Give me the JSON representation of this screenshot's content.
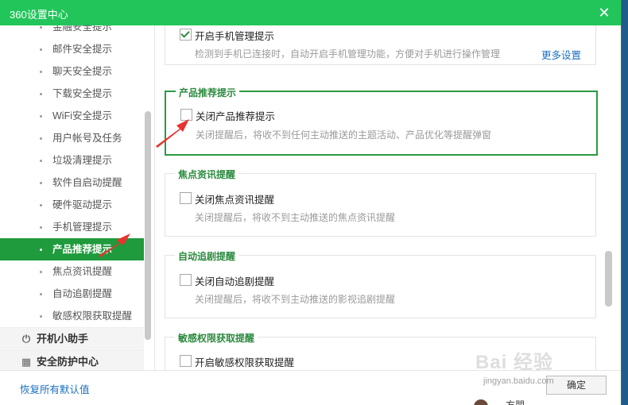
{
  "window": {
    "title": "360设置中心",
    "close_glyph": "✕"
  },
  "sidebar": {
    "items": [
      {
        "label": "金融安全提示",
        "active": false
      },
      {
        "label": "邮件安全提示",
        "active": false
      },
      {
        "label": "聊天安全提示",
        "active": false
      },
      {
        "label": "下载安全提示",
        "active": false
      },
      {
        "label": "WiFi安全提示",
        "active": false
      },
      {
        "label": "用户帐号及任务",
        "active": false
      },
      {
        "label": "垃圾清理提示",
        "active": false
      },
      {
        "label": "软件自启动提醒",
        "active": false
      },
      {
        "label": "硬件驱动提示",
        "active": false
      },
      {
        "label": "手机管理提示",
        "active": false
      },
      {
        "label": "产品推荐提示",
        "active": true
      },
      {
        "label": "焦点资讯提醒",
        "active": false
      },
      {
        "label": "自动追剧提醒",
        "active": false
      },
      {
        "label": "敏感权限获取提醒",
        "active": false
      }
    ],
    "groups": [
      {
        "label": "开机小助手",
        "icon": "power-icon"
      },
      {
        "label": "安全防护中心",
        "icon": "shield-grid-icon"
      }
    ]
  },
  "main": {
    "phone": {
      "checkbox_label": "开启手机管理提示",
      "checked": true,
      "desc": "检测到手机已连接时，自动开启手机管理功能，方便对手机进行操作管理",
      "more_link": "更多设置"
    },
    "product": {
      "title": "产品推荐提示",
      "checkbox_label": "关闭产品推荐提示",
      "checked": false,
      "desc": "关闭提醒后，将收不到任何主动推送的主题活动、产品优化等提醒弹窗"
    },
    "news": {
      "title": "焦点资讯提醒",
      "checkbox_label": "关闭焦点资讯提醒",
      "checked": false,
      "desc": "关闭提醒后，将收不到主动推送的焦点资讯提醒"
    },
    "drama": {
      "title": "自动追剧提醒",
      "checkbox_label": "关闭自动追剧提醒",
      "checked": false,
      "desc": "关闭提醒后，将收不到主动推送的影视追剧提醒"
    },
    "permission": {
      "title": "敏感权限获取提醒",
      "checkbox_label": "开启敏感权限获取提醒",
      "checked": false
    }
  },
  "footer": {
    "restore_link": "恢复所有默认值",
    "ok_button": "确定",
    "avatar_name": "方朋"
  },
  "watermark": {
    "main": "Bai 经验",
    "sub": "jingyan.baidu.com"
  },
  "colors": {
    "titlebar": "#22c55a",
    "accent": "#1f9a3c",
    "link": "#1a6fc2",
    "arrow": "#e8322f"
  }
}
